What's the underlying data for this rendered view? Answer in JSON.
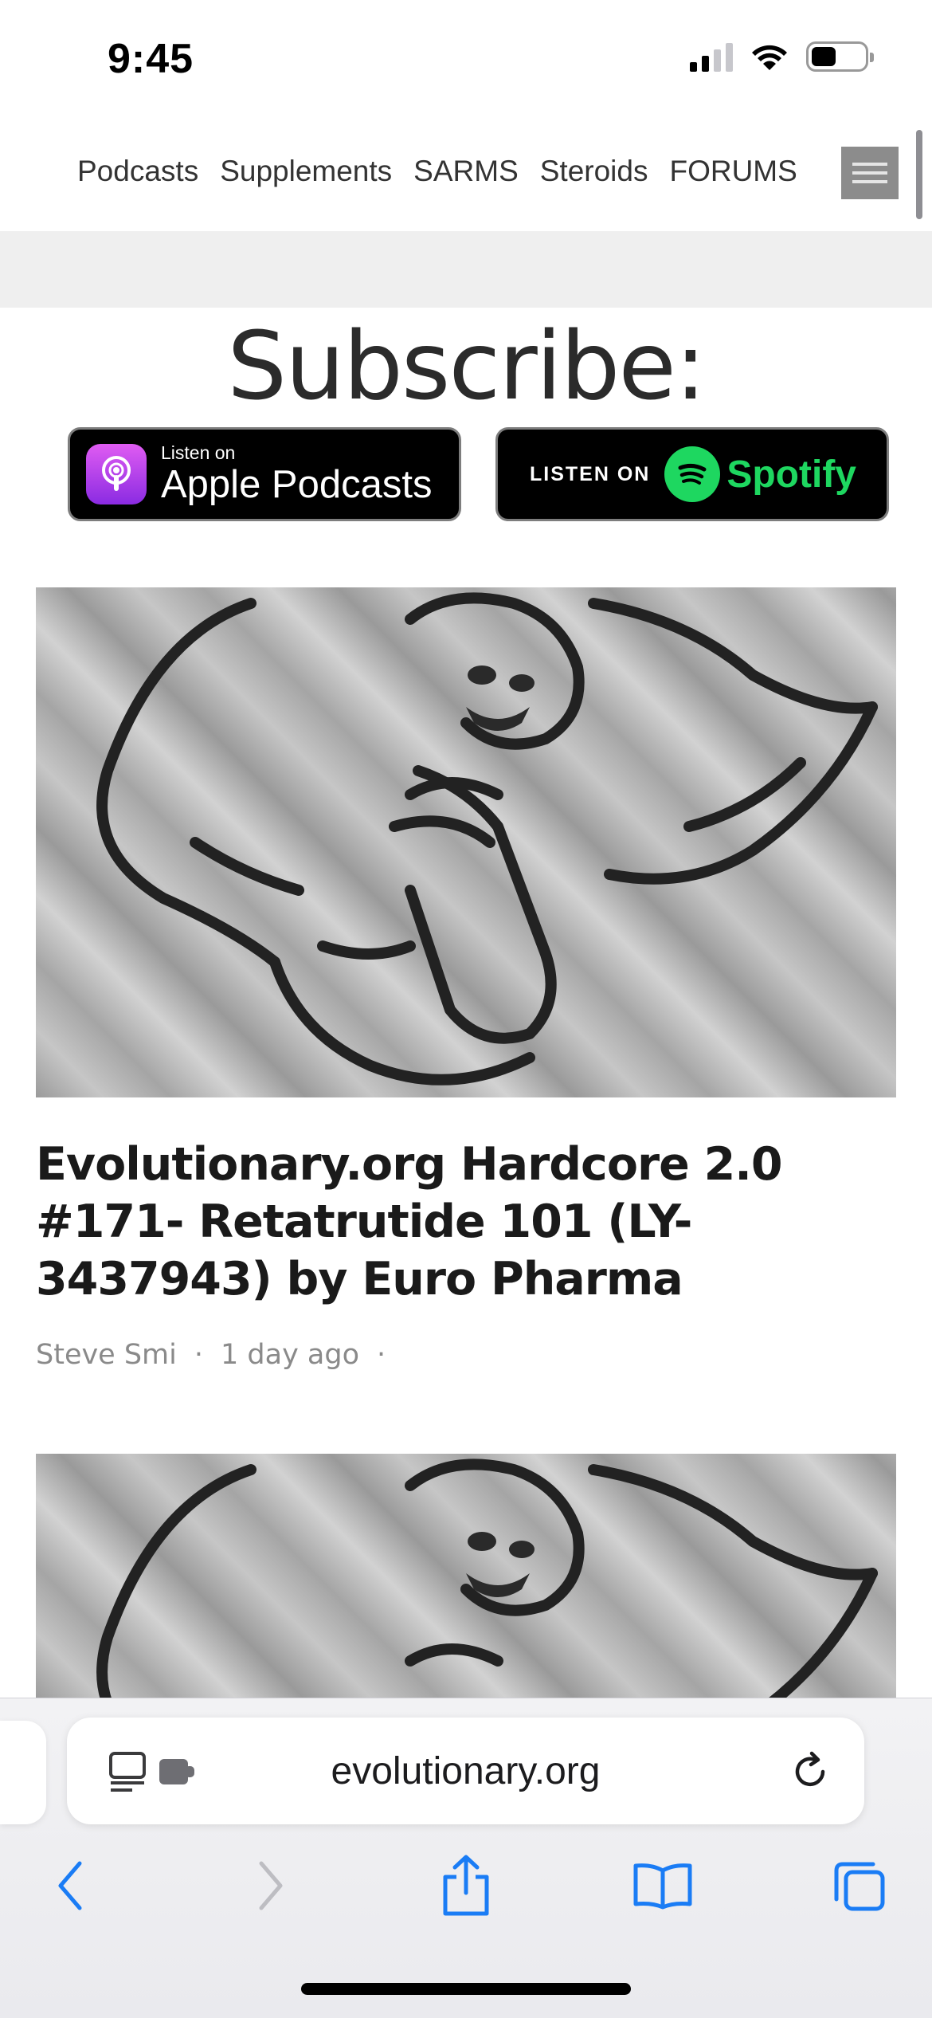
{
  "status_bar": {
    "time": "9:45"
  },
  "site_nav": {
    "links": [
      "Podcasts",
      "Supplements",
      "SARMS",
      "Steroids",
      "FORUMS"
    ]
  },
  "subscribe": {
    "heading": "Subscribe:",
    "apple_badge": {
      "small": "Listen on",
      "big": "Apple Podcasts"
    },
    "spotify_badge": {
      "listen": "LISTEN ON",
      "name": "Spotify"
    }
  },
  "article": {
    "title": "Evolutionary.org Hardcore 2.0 #171- Retatrutide 101 (LY-3437943) by Euro Pharma",
    "author": "Steve Smi",
    "date": "1 day ago",
    "separator": "·"
  },
  "browser": {
    "url": "evolutionary.org"
  },
  "colors": {
    "spotify_green": "#1ed760",
    "safari_blue": "#1a7cf5",
    "apple_podcast_purple": "#b150e2"
  },
  "icons": [
    "signal-icon",
    "wifi-icon",
    "battery-icon",
    "menu-icon",
    "apple-podcasts-icon",
    "spotify-icon",
    "reader-mode-icon",
    "extension-icon",
    "reload-icon",
    "back-icon",
    "forward-icon",
    "share-icon",
    "bookmarks-icon",
    "tabs-icon"
  ]
}
